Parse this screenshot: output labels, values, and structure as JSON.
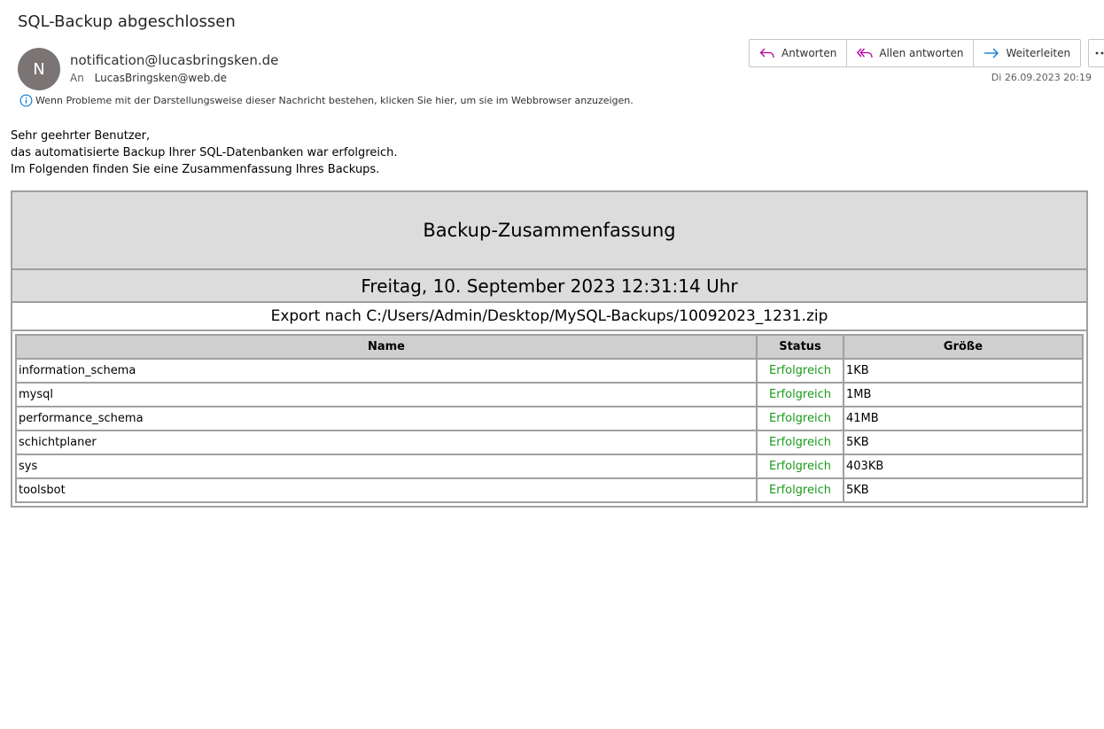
{
  "email": {
    "subject": "SQL-Backup abgeschlossen",
    "avatar_initial": "N",
    "sender": "notification@lucasbringsken.de",
    "to_label": "An",
    "recipient": "LucasBringsken@web.de",
    "info_notice": "Wenn Probleme mit der Darstellungsweise dieser Nachricht bestehen, klicken Sie hier, um sie im Webbrowser anzuzeigen.",
    "date": "Di 26.09.2023 20:19",
    "actions": {
      "reply": "Antworten",
      "reply_all": "Allen antworten",
      "forward": "Weiterleiten"
    }
  },
  "body": {
    "greeting": "Sehr geehrter Benutzer,",
    "line1": "das automatisierte Backup Ihrer SQL-Datenbanken war erfolgreich.",
    "line2": "Im Folgenden finden Sie eine Zusammenfassung Ihres Backups."
  },
  "summary": {
    "title": "Backup-Zusammenfassung",
    "datetime": "Freitag, 10. September 2023 12:31:14 Uhr",
    "export": "Export nach C:/Users/Admin/Desktop/MySQL-Backups/10092023_1231.zip",
    "columns": [
      "Name",
      "Status",
      "Größe"
    ],
    "rows": [
      {
        "name": "information_schema",
        "status": "Erfolgreich",
        "size": "1KB"
      },
      {
        "name": "mysql",
        "status": "Erfolgreich",
        "size": "1MB"
      },
      {
        "name": "performance_schema",
        "status": "Erfolgreich",
        "size": "41MB"
      },
      {
        "name": "schichtplaner",
        "status": "Erfolgreich",
        "size": "5KB"
      },
      {
        "name": "sys",
        "status": "Erfolgreich",
        "size": "403KB"
      },
      {
        "name": "toolsbot",
        "status": "Erfolgreich",
        "size": "5KB"
      }
    ]
  },
  "colors": {
    "accent_reply": "#b4009e",
    "accent_forward": "#0078d4",
    "status_success": "#1a9a1a",
    "avatar_bg": "#7a7574"
  },
  "icons": {
    "reply": "reply-icon",
    "reply_all": "reply-all-icon",
    "forward": "forward-icon",
    "more": "more-icon",
    "info": "info-icon"
  }
}
